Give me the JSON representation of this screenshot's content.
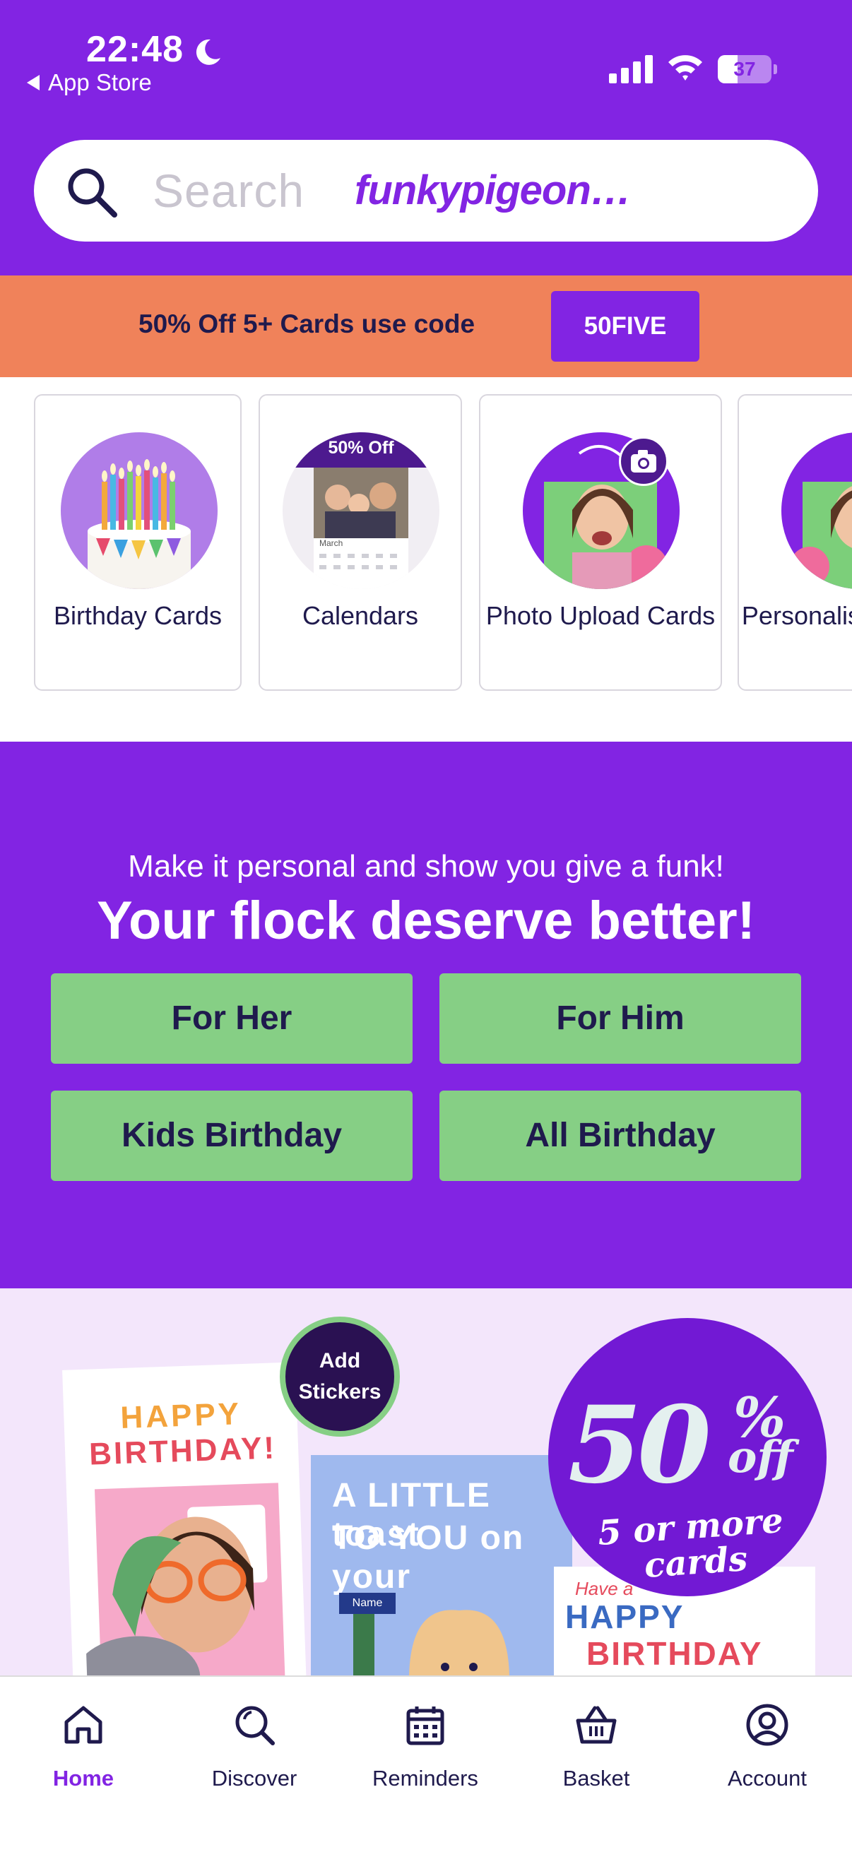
{
  "status_bar": {
    "time": "22:48",
    "back_label": "App Store",
    "battery": "37",
    "battery_level": 0.37
  },
  "search": {
    "placeholder": "Search",
    "brand": "funkypigeon…"
  },
  "promo": {
    "text": "50% Off 5+ Cards use code",
    "code": "50FIVE"
  },
  "categories": [
    {
      "label": "Birthday Cards"
    },
    {
      "label": "Calendars",
      "badge": "50% Off",
      "month": "March"
    },
    {
      "label": "Photo Upload Cards"
    },
    {
      "label": "Personalised Gifts"
    }
  ],
  "flock": {
    "subtitle": "Make it personal and show you give a funk!",
    "title": "Your flock deserve better!",
    "buttons": [
      {
        "label": "For Her"
      },
      {
        "label": "For Him"
      },
      {
        "label": "Kids Birthday"
      },
      {
        "label": "All Birthday"
      }
    ]
  },
  "banner": {
    "stickers": "Add Stickers",
    "card1_line1": "HAPPY",
    "card1_line2": "BIRTHDAY!",
    "card2_line1": "A LITTLE toast",
    "card2_line2": "TO YOU on your",
    "card3_small": "Have a",
    "card3_line1": "HAPPY",
    "card3_line2": "BIRTHDAY",
    "offer_big": "50",
    "offer_pct": "%",
    "offer_off": "off",
    "offer_sub1": "5 or more",
    "offer_sub2": "cards",
    "name_tag": "Name"
  },
  "nav": {
    "items": [
      {
        "label": "Home",
        "icon": "home-icon",
        "active": true
      },
      {
        "label": "Discover",
        "icon": "search-icon"
      },
      {
        "label": "Reminders",
        "icon": "calendar-icon"
      },
      {
        "label": "Basket",
        "icon": "basket-icon"
      },
      {
        "label": "Account",
        "icon": "account-icon"
      }
    ]
  },
  "colors": {
    "brand_purple": "#8224e3",
    "promo_orange": "#f0825a",
    "button_green": "#86cf85",
    "navy_text": "#1f1a4d",
    "banner_bg": "#f3e6fb"
  }
}
